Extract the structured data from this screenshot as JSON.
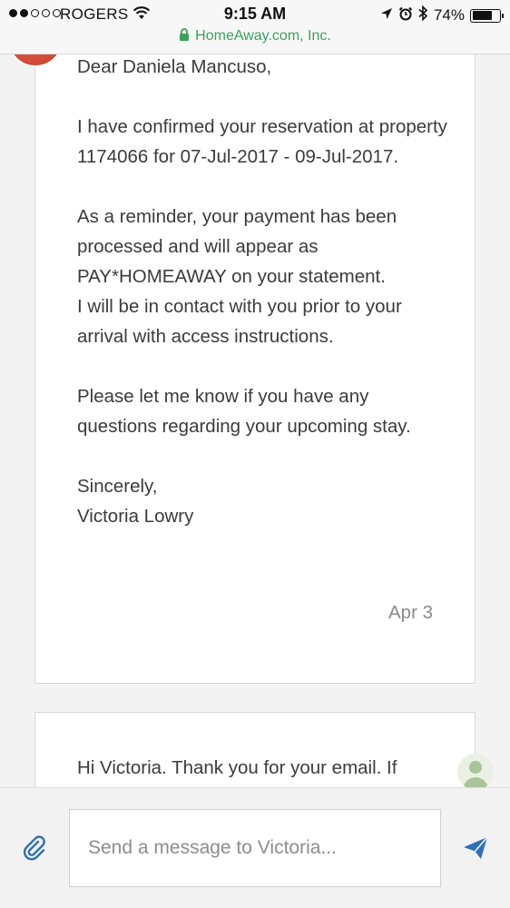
{
  "status_bar": {
    "carrier": "ROGERS",
    "time": "9:15 AM",
    "battery_percent": "74%",
    "battery_level": 0.74,
    "signal_bars_filled": 2,
    "signal_bars_total": 5,
    "url": "HomeAway.com, Inc.",
    "url_color": "#3aa35a"
  },
  "messages": [
    {
      "body": "Dear Daniela Mancuso,\n\nI have confirmed your reservation at property 1174066 for 07-Jul-2017 - 09-Jul-2017.\n\nAs a reminder, your payment has been processed and will appear as PAY*HOMEAWAY on your statement.\nI will be in contact with you prior to your arrival with access instructions.\n\nPlease let me know if you have any questions regarding your upcoming stay.\n\nSincerely,\nVictoria Lowry",
      "date": "Apr 3"
    },
    {
      "body": "Hi Victoria. Thank you for your email. If"
    }
  ],
  "composer": {
    "placeholder": "Send a message to Victoria...",
    "value": "",
    "attach_icon": "paperclip-icon",
    "send_icon": "send-icon",
    "accent": "#2e6fb7"
  }
}
